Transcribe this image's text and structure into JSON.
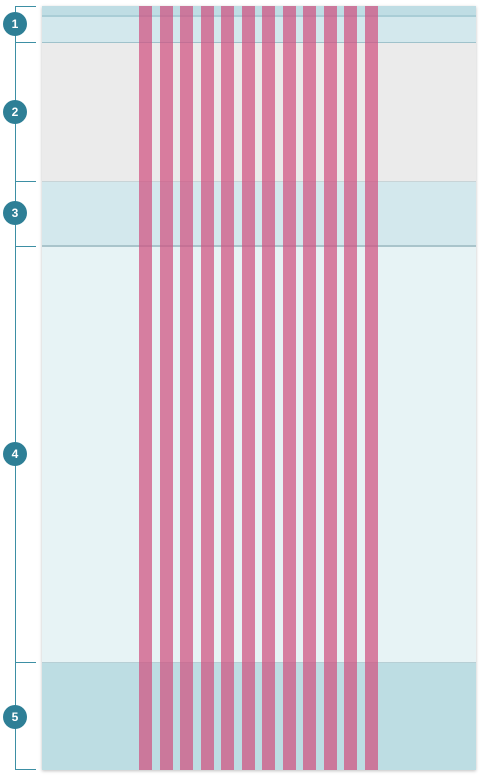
{
  "markers": [
    {
      "label": "1"
    },
    {
      "label": "2"
    },
    {
      "label": "3"
    },
    {
      "label": "4"
    },
    {
      "label": "5"
    }
  ],
  "colors": {
    "marker": "#2e7f96",
    "bracket": "#3d8fa4",
    "column_overlay": "#d05080",
    "hero_region": "#ebebeb",
    "toolbar_region": "#d3e8ed",
    "content_region": "#e7f3f5",
    "footer_region": "#bddde3"
  },
  "grid": {
    "column_count": 12
  }
}
